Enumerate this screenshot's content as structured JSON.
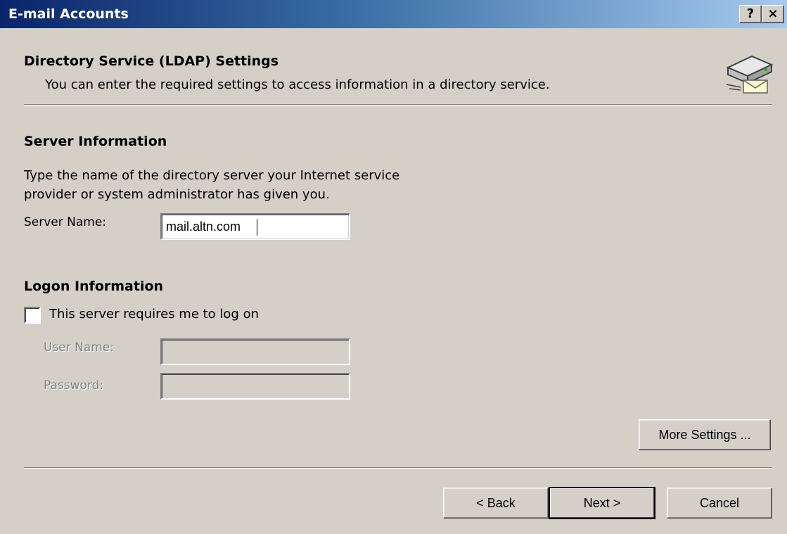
{
  "window": {
    "title": "E-mail Accounts",
    "help_label": "?",
    "close_label": "×"
  },
  "header": {
    "title": "Directory Service (LDAP) Settings",
    "subtitle": "You can enter the required settings to access information in a directory service.",
    "icon": "directory-server-mail-icon"
  },
  "server_info": {
    "heading": "Server Information",
    "description_line1": "Type the name of the directory server your Internet service",
    "description_line2": "provider or system administrator has given you.",
    "server_name_label": "Server Name:",
    "server_name_value": "mail.altn.com"
  },
  "logon_info": {
    "heading": "Logon Information",
    "requires_logon_label": "This server requires me to log on",
    "requires_logon_checked": false,
    "user_name_label": "User Name:",
    "user_name_value": "",
    "password_label": "Password:",
    "password_value": ""
  },
  "buttons": {
    "more_settings": "More Settings ...",
    "back": "< Back",
    "next": "Next >",
    "cancel": "Cancel"
  }
}
